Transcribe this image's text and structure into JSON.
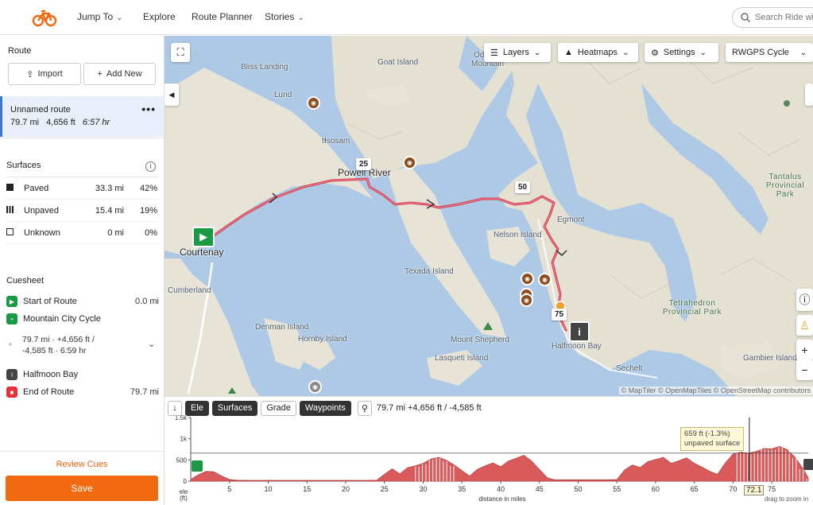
{
  "nav": {
    "logo_icon": "bicycle-logo-icon",
    "items": [
      {
        "label": "Jump To",
        "dropdown": true
      },
      {
        "label": "Explore",
        "dropdown": false
      },
      {
        "label": "Route Planner",
        "dropdown": false
      },
      {
        "label": "Stories",
        "dropdown": true
      }
    ],
    "search_placeholder": "Search Ride with GPS"
  },
  "sidebar": {
    "route_heading": "Route",
    "import_label": "Import",
    "add_new_label": "Add New",
    "route": {
      "name": "Unnamed route",
      "distance": "79.7 mi",
      "gain": "4,656 ft",
      "time": "6:57 hr"
    },
    "surfaces_heading": "Surfaces",
    "surfaces": [
      {
        "label": "Paved",
        "distance": "33.3 mi",
        "percent": "42%"
      },
      {
        "label": "Unpaved",
        "distance": "15.4 mi",
        "percent": "19%"
      },
      {
        "label": "Unknown",
        "distance": "0 mi",
        "percent": "0%"
      }
    ],
    "cuesheet_heading": "Cuesheet",
    "cues": [
      {
        "label": "Start of Route",
        "value": "0.0 mi",
        "color": "#1a9a45"
      },
      {
        "label": "Mountain City Cycle",
        "value": "",
        "color": "#1a9a45"
      },
      {
        "label": "Halfmoon Bay",
        "value": "",
        "color": "#444444"
      },
      {
        "label": "End of Route",
        "value": "79.7 mi",
        "color": "#e8303a"
      }
    ],
    "segment_line1": "79.7 mi · +4,656 ft /",
    "segment_line2": "-4,585 ft · 6:59 hr",
    "review_label": "Review Cues",
    "save_label": "Save"
  },
  "map": {
    "controls": {
      "layers": "Layers",
      "heatmaps": "Heatmaps",
      "settings": "Settings",
      "basemap": "RWGPS Cycle"
    },
    "labels": {
      "goat_island": "Goat Island",
      "bliss_landing": "Bliss Landing",
      "lund": "Lund",
      "tlisosam": "tɬsosam",
      "powell_river": "Powell River",
      "egmont": "Egmont",
      "nelson_island": "Nelson Island",
      "texada_island": "Texada Island",
      "courtenay": "Courtenay",
      "cumberland": "Cumberland",
      "denman_island": "Denman Island",
      "hornby_island": "Hornby Island",
      "mount_shepherd": "Mount Shepherd",
      "lasqueti_island": "Lasqueti Island",
      "halfmoon_bay": "Halfmoon Bay",
      "sechelt": "Sechelt",
      "tetrahedron": "Tetrahedron Provincial Park",
      "tantalus": "Tantalus Provincial Park",
      "gambier_island": "Gambier Island",
      "mountain": "Mountain",
      "od": "Od"
    },
    "mile_markers": [
      "25",
      "50",
      "75"
    ],
    "attribution": "© MapTiler © OpenMapTiles © OpenStreetMap contributors",
    "route_color": "#d23a4e",
    "water_color": "#aec9e6",
    "land_color": "#e8e4da"
  },
  "elevation": {
    "tabs": {
      "ele": "Ele",
      "surfaces": "Surfaces",
      "grade": "Grade",
      "waypoints": "Waypoints"
    },
    "summary": "79.7 mi +4,656 ft / -4,585 ft",
    "y_ticks": [
      "1.5k",
      "1k",
      "500",
      "0"
    ],
    "x_ticks": [
      "5",
      "10",
      "15",
      "20",
      "25",
      "30",
      "35",
      "40",
      "45",
      "50",
      "55",
      "60",
      "65",
      "70",
      "75"
    ],
    "y_label_1": "ele",
    "y_label_2": "(ft)",
    "x_label": "distance in miles",
    "tooltip_line1": "659 ft (-1.3%)",
    "tooltip_line2": "unpaved surface",
    "cursor_position": "72.1",
    "drag_hint": "drag to zoom in",
    "fill_color": "#d85a5a"
  },
  "chart_data": {
    "type": "area",
    "x": [
      0,
      1,
      2,
      3,
      4,
      5,
      6,
      7,
      8,
      9,
      10,
      11,
      12,
      13,
      14,
      15,
      16,
      17,
      18,
      19,
      20,
      21,
      22,
      23,
      24,
      25,
      26,
      27,
      28,
      29,
      30,
      31,
      32,
      33,
      34,
      35,
      36,
      37,
      38,
      39,
      40,
      41,
      42,
      43,
      44,
      45,
      46,
      47,
      48,
      49,
      50,
      51,
      52,
      53,
      54,
      55,
      56,
      57,
      58,
      59,
      60,
      61,
      62,
      63,
      64,
      65,
      66,
      67,
      68,
      69,
      70,
      71,
      72,
      73,
      74,
      75,
      76,
      77,
      78,
      79,
      79.7
    ],
    "series": [
      {
        "values": [
          40,
          150,
          230,
          220,
          120,
          40,
          20,
          15,
          15,
          15,
          15,
          15,
          15,
          15,
          15,
          15,
          15,
          15,
          15,
          15,
          15,
          15,
          15,
          15,
          20,
          160,
          290,
          170,
          320,
          360,
          420,
          520,
          560,
          490,
          380,
          250,
          120,
          280,
          360,
          430,
          340,
          470,
          540,
          610,
          470,
          280,
          80,
          30,
          30,
          30,
          30,
          30,
          30,
          30,
          30,
          35,
          260,
          380,
          320,
          460,
          510,
          560,
          420,
          480,
          550,
          420,
          330,
          230,
          160,
          430,
          640,
          680,
          659,
          700,
          770,
          760,
          820,
          740,
          560,
          300,
          80
        ]
      }
    ],
    "xlabel": "distance in miles",
    "ylabel": "ele (ft)",
    "xlim": [
      0,
      79.7
    ],
    "ylim": [
      0,
      1500
    ],
    "grid": false
  }
}
